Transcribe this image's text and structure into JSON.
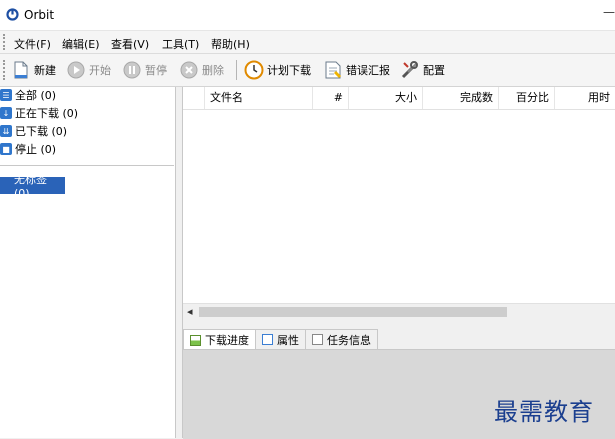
{
  "window": {
    "title": "Orbit",
    "minimize_glyph": "—"
  },
  "menu": [
    "文件(F)",
    "编辑(E)",
    "查看(V)",
    "工具(T)",
    "帮助(H)"
  ],
  "toolbar": {
    "new": "新建",
    "start": "开始",
    "pause": "暂停",
    "delete": "删除",
    "schedule": "计划下载",
    "report": "错误汇报",
    "config": "配置"
  },
  "categories": [
    {
      "label": "全部 (0)",
      "color": "#2f76cc"
    },
    {
      "label": "正在下载 (0)",
      "color": "#2f76cc"
    },
    {
      "label": "已下载 (0)",
      "color": "#2f76cc"
    },
    {
      "label": "停止 (0)",
      "color": "#2f76cc"
    }
  ],
  "tag": {
    "label": "无标签 (0)"
  },
  "table": {
    "columns": [
      "文件名",
      "#",
      "大小",
      "完成数",
      "百分比",
      "用时"
    ]
  },
  "tabs": [
    "下载进度",
    "属性",
    "任务信息"
  ],
  "watermark": "最需教育"
}
